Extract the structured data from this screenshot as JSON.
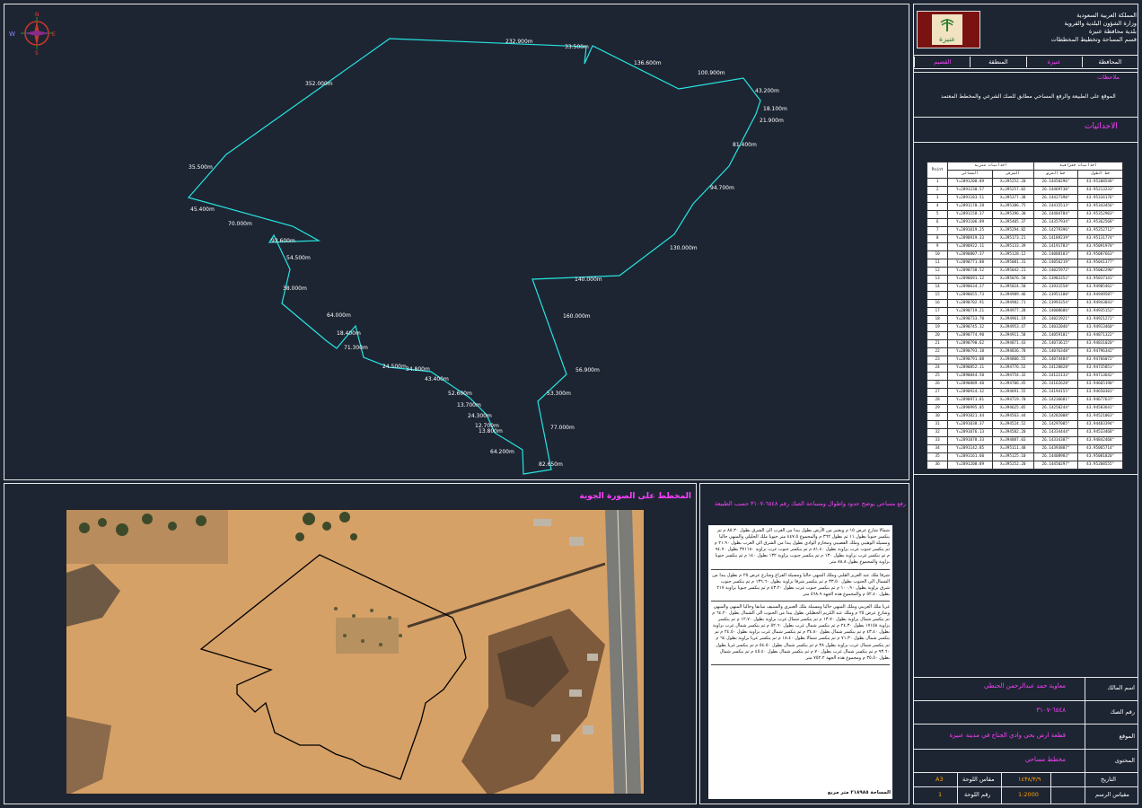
{
  "compass": {
    "north": "N",
    "south": "S",
    "east": "E",
    "west": "W"
  },
  "plot": {
    "segment_labels": [
      {
        "text": "232.900m"
      },
      {
        "text": "33.500m"
      },
      {
        "text": "136.600m"
      },
      {
        "text": "100.900m"
      },
      {
        "text": "43.200m"
      },
      {
        "text": "18.100m"
      },
      {
        "text": "21.900m"
      },
      {
        "text": "81.400m"
      },
      {
        "text": "94.700m"
      },
      {
        "text": "130.000m"
      },
      {
        "text": "140.000m"
      },
      {
        "text": "160.000m"
      },
      {
        "text": "56.900m"
      },
      {
        "text": "53.300m"
      },
      {
        "text": "77.000m"
      },
      {
        "text": "82.650m"
      },
      {
        "text": "64.200m"
      },
      {
        "text": "13.800m"
      },
      {
        "text": "12.700m"
      },
      {
        "text": "24.300m"
      },
      {
        "text": "13.700m"
      },
      {
        "text": "52.600m"
      },
      {
        "text": "43.400m"
      },
      {
        "text": "34.800m"
      },
      {
        "text": "24.500m"
      },
      {
        "text": "71.300m"
      },
      {
        "text": "18.400m"
      },
      {
        "text": "64.000m"
      },
      {
        "text": "38.000m"
      },
      {
        "text": "54.500m"
      },
      {
        "text": "93.600m"
      },
      {
        "text": "70.000m"
      },
      {
        "text": "45.400m"
      },
      {
        "text": "35.500m"
      },
      {
        "text": "352.000m"
      }
    ]
  },
  "photo": {
    "title": "المخطط على الصورة الجوية"
  },
  "notes": {
    "title": "رفع مساحي يوضح حدود واطوال ومساحة الصك رقم ٦٥٤٨-٣١٠٧ حسب الطبيعة",
    "paragraphs": [
      "شمالا شارع عرض ١٥ م ويعتبر من الأرض بطول يبدا من الغرب الى الشرق بطول ٨٥.٣٠ م ثم ينكسر جنوبا بطول ١١ ثم بطول ٣٦٢ م والمجموع ٤٤٧.٥ متر جنوبا ملك الجليلي والمنهي حاليا ومسيلة الوهيبي وملك القضيبي ومحارم الوادي بطول يبدا من الشرق الى الغرب بطول ٢١.٩٠ م ثم ينكسر جنوب غرب بزاوية بطول ٨١.٤٠ م ثم ينكسر جنوب غرب بزاوية ٣٧١١٨٠ بطول ٩٤.٧٠ م ثم ينكسر غرب بزاوية بطول ١٣٠ م ثم ينكسر جنوب بزاوية ١٣٢ بطول ١٤٠ م ثم ينكسر جنوبا بزاوية والمجموع بطول ٨٨.٨ متر",
      "شرقا ملك عبد العزيز القلبي وملك المنهي حاليا ومسيلة الفراغ وشارع عرض ٢٥ م بطول يبدا من الشمال الى الجنوب بطول ٣٣.٥٠ م ثم ينكسر شرقا بزاوية بطول ١٣٦.٦٠ م ثم ينكسر جنوب شرق بزاوية بطول ١٠٠.٩٠ م ثم ينكسر جنوب غرب بطول ٤٣.٢٠ م ثم ينكسر جنوبا بزاوية ٢١٧ بطول ٥٢.٤٠ م والمجموع هذه الجهة ٥٦٨.٩ متر",
      "غربا ملك العريبي وملك المنهي حاليا ومسيلة ملك الغبيري والسنيف سابقا وحاليا المنهي والمنهي وشارع عرض ٢٥ م وملك عبد الكريم الحطيلي بطول يبدا من الجنوب الى الشمال بطول ٦٤.٢٠ م ثم ينكسر شمال بزاوية بطول ١٣.٧٠ م ثم ينكسر شمال غرب بزاوية بطول ١٢.٧٠ م ثم ينكسر بزاوية ١٧١٥٨ بطول ٢٤.٣٠ م ثم ينكسر شمال غرب بطول ٥٢.٦٠ م ثم ينكسر شمال غرب بزاوية بطول ٤٣.٤٠ م ثم ينكسر شمال بطول ٣٤.٨٠ م ثم ينكسر شمال غرب بزاوية بطول ٢٤.٥٠ م ثم ينكسر شمال بطول ٧١.٣٠ م ثم ينكسر شمالا بطول ١٨.٤٠ م ثم ينكسر غربا بزاوية بطول ٦٤ م ثم ينكسر شمال غرب بزاوية بطول ٣٨ م ثم ينكسر شمال بطول ٥٤.٥٠ م ثم ينكسر غربا بطول ٩٣.٦٠ م ثم ينكسر شمال غرب بطول ٧٠ م ثم ينكسر شمال بطول ٤٥.٤٠ م ثم ينكسر شمال بطول ٣٥.٥٠ م ومجموع هذه الجهة ٧٥٢.٢ متر"
    ],
    "area": "المساحة ٢١٨٩٨٥ متر مربع"
  },
  "title_block": {
    "gov_lines": [
      "المملكة العربية السعودية",
      "وزارة الشؤون البلدية والقروية",
      "بلدية محافظة عنيزة",
      "قسم المساحة وتخطيط المخططات"
    ],
    "logo_text": "عنيزة",
    "tabs": [
      "المحافظة",
      "عنيزة",
      "المنطقة",
      "القصيم"
    ],
    "notes_label": "ملاحظات",
    "notes_text": "الموقع على الطبيعة والرفع المساحي مطابق للصك الشرعي والمخطط المعتمد",
    "coords_label": "الاحداثيات",
    "table_headers": {
      "point": "Point",
      "geo_group": "احداثيات جغرافية",
      "utm_group": "احداثيات مترية",
      "lat": "خط العرض",
      "lon": "خط الطول",
      "north": "الشمالي",
      "east": "الشرقي"
    },
    "fields": [
      {
        "label": "اسم المالك",
        "value": "معاوية حمد عبدالرحمن الحنطي"
      },
      {
        "label": "رقم الصك",
        "value": "٦٥٤٨-٣١٠٧"
      },
      {
        "label": "الموقع",
        "value": "قطعة ارض بحي وادي الجناح في مدينة عنيزة"
      },
      {
        "label": "المحتوى",
        "value": "مخطط مساحي"
      }
    ],
    "footer": {
      "date_label": "التاريخ",
      "date_value": "١٤٣٨/٣/٩",
      "sheet_size_label": "مقاس اللوحة",
      "sheet_size_value": "A3",
      "scale_label": "مقياس الرسم",
      "scale_value": "1:2000",
      "sheet_no_label": "رقم اللوحة",
      "sheet_no_value": "1"
    }
  },
  "coordinates": [
    {
      "p": "1",
      "lat": "26.14450296°",
      "lon": "43.95208548°",
      "x": "X=395252.20",
      "y": "Y=2891208.89"
    },
    {
      "p": "2",
      "lat": "26.14469730°",
      "lon": "43.95213233°",
      "x": "X=395257.02",
      "y": "Y=2891230.57"
    },
    {
      "p": "3",
      "lat": "26.14427390°",
      "lon": "43.95334176°",
      "x": "X=395377.38",
      "y": "Y=2891183.51"
    },
    {
      "p": "4",
      "lat": "26.14415513°",
      "lon": "43.95343456°",
      "x": "X=395386.75",
      "y": "Y=2891170.28"
    },
    {
      "p": "5",
      "lat": "26.14404784°",
      "lon": "43.95352903°",
      "x": "X=395396.30",
      "y": "Y=2891158.37"
    },
    {
      "p": "6",
      "lat": "26.14357934°",
      "lon": "43.95362568°",
      "x": "X=395405.37",
      "y": "Y=2891106.89"
    },
    {
      "p": "7",
      "lat": "26.14279396°",
      "lon": "43.95252712°",
      "x": "X=395294.82",
      "y": "Y=2891019.25"
    },
    {
      "p": "8",
      "lat": "26.14189239°",
      "lon": "43.95131774°",
      "x": "X=395173.21",
      "y": "Y=2890919.33"
    },
    {
      "p": "9",
      "lat": "26.14191783°",
      "lon": "43.95091978°",
      "x": "X=395133.39",
      "y": "Y=2890922.11"
    },
    {
      "p": "10",
      "lat": "26.14088183°",
      "lon": "43.95087663°",
      "x": "X=395128.12",
      "y": "Y=2890807.37"
    },
    {
      "p": "11",
      "lat": "26.14056219°",
      "lon": "43.95041377°",
      "x": "X=395081.31",
      "y": "Y=2890771.88"
    },
    {
      "p": "12",
      "lat": "26.14025972°",
      "lon": "43.95002290°",
      "x": "X=395042.21",
      "y": "Y=2890738.52"
    },
    {
      "p": "13",
      "lat": "26.13983352°",
      "lon": "43.95037141°",
      "x": "X=395076.50",
      "y": "Y=2890691.12"
    },
    {
      "p": "14",
      "lat": "26.13931558°",
      "lon": "43.94985462°",
      "x": "X=395024.50",
      "y": "Y=2890634.27"
    },
    {
      "p": "15",
      "lat": "26.13951180°",
      "lon": "43.94949587°",
      "x": "X=394989.46",
      "y": "Y=2890655.73"
    },
    {
      "p": "16",
      "lat": "26.13993354°",
      "lon": "43.94943043°",
      "x": "X=394982.71",
      "y": "Y=2890702.91"
    },
    {
      "p": "17",
      "lat": "26.14008686°",
      "lon": "43.94935152°",
      "x": "X=394977.28",
      "y": "Y=2890719.21"
    },
    {
      "p": "18",
      "lat": "26.14021921°",
      "lon": "43.94921271°",
      "x": "X=394961.19",
      "y": "Y=2890733.70"
    },
    {
      "p": "19",
      "lat": "26.14032046°",
      "lon": "43.94913460°",
      "x": "X=394953.47",
      "y": "Y=2890745.32"
    },
    {
      "p": "20",
      "lat": "26.14059101°",
      "lon": "43.94871322°",
      "x": "X=394911.58",
      "y": "Y=2890774.90"
    },
    {
      "p": "21",
      "lat": "26.14073615°",
      "lon": "43.94831020°",
      "x": "X=394871.43",
      "y": "Y=2890790.62"
    },
    {
      "p": "22",
      "lat": "26.14076348°",
      "lon": "43.94796342°",
      "x": "X=394836.78",
      "y": "Y=2890793.18"
    },
    {
      "p": "23",
      "lat": "26.14074484°",
      "lon": "43.94766072°",
      "x": "X=394806.55",
      "y": "Y=2890791.08"
    },
    {
      "p": "24",
      "lat": "26.14128828°",
      "lon": "43.94735851°",
      "x": "X=394776.52",
      "y": "Y=2890852.11"
    },
    {
      "p": "25",
      "lat": "26.14122133°",
      "lon": "43.94713642°",
      "x": "X=394754.32",
      "y": "Y=2890844.50"
    },
    {
      "p": "26",
      "lat": "26.14162628°",
      "lon": "43.94665190°",
      "x": "X=394706.45",
      "y": "Y=2890889.40"
    },
    {
      "p": "27",
      "lat": "26.14194155°",
      "lon": "43.94650301°",
      "x": "X=394691.55",
      "y": "Y=2890924.32"
    },
    {
      "p": "28",
      "lat": "26.14236681°",
      "lon": "43.94677637°",
      "x": "X=394719.70",
      "y": "Y=2890971.81"
    },
    {
      "p": "29",
      "lat": "26.14258244°",
      "lon": "43.94583641°",
      "x": "X=394625.05",
      "y": "Y=2890995.05"
    },
    {
      "p": "30",
      "lat": "26.14282008°",
      "lon": "43.94521063°",
      "x": "X=394563.44",
      "y": "Y=2891021.44"
    },
    {
      "p": "31",
      "lat": "26.14297085°",
      "lon": "43.94483394°",
      "x": "X=394524.52",
      "y": "Y=2891038.37"
    },
    {
      "p": "32",
      "lat": "26.14334444°",
      "lon": "43.94533468°",
      "x": "X=394582.20",
      "y": "Y=2891076.13"
    },
    {
      "p": "33",
      "lat": "26.14334387°",
      "lon": "43.94842468°",
      "x": "X=394887.03",
      "y": "Y=2891078.33"
    },
    {
      "p": "34",
      "lat": "26.14393887°",
      "lon": "43.95065714°",
      "x": "X=395111.48",
      "y": "Y=2891142.85"
    },
    {
      "p": "35",
      "lat": "26.14408983°",
      "lon": "43.95081820°",
      "x": "X=395125.10",
      "y": "Y=2891161.60"
    },
    {
      "p": "36",
      "lat": "26.14450297°",
      "lon": "43.95208555°",
      "x": "X=395252.20",
      "y": "Y=2891208.89"
    }
  ],
  "colors": {
    "background": "#1d2533",
    "boundary": "#27e4e0",
    "accent": "#ff3fff",
    "frame": "#e8e8e8"
  }
}
